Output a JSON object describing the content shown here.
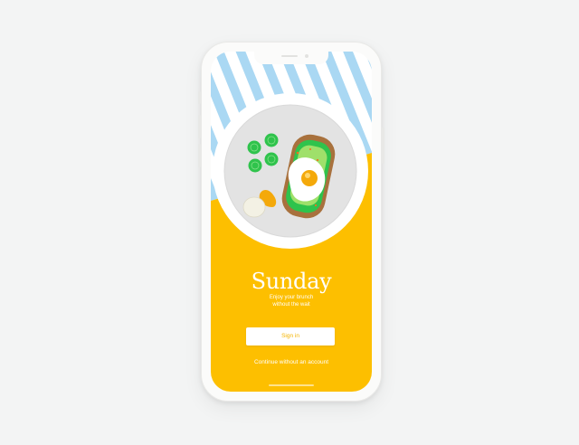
{
  "app": {
    "title": "Sunday",
    "tagline_line1": "Enjoy your brunch",
    "tagline_line2": "without the wait"
  },
  "actions": {
    "signin_label": "Sign in",
    "continue_label": "Continue without an account"
  },
  "illustration": {
    "subject": "brunch plate with avocado toast, fried egg, cucumber slices and boiled egg",
    "icons": [
      "striped-tablecloth",
      "plate",
      "avocado-toast",
      "fried-egg",
      "cucumber-slice",
      "boiled-egg"
    ]
  },
  "colors": {
    "background": "#f3f4f4",
    "brand_yellow": "#fdbf00",
    "stripe_blue": "#aad8f3",
    "plate_outer": "#ffffff",
    "plate_inner": "#e3e3e3",
    "cucumber_green": "#2fc34c",
    "toast_brown": "#a8713d",
    "yolk_orange": "#f4a90a",
    "button_text": "#f4b400"
  }
}
